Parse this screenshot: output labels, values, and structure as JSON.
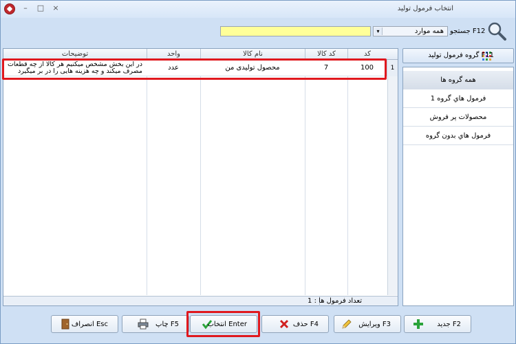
{
  "window": {
    "title": "انتخاب فرمول تولید",
    "min_glyph": "–",
    "max_glyph": "□",
    "close_glyph": "×"
  },
  "search": {
    "placeholder": "",
    "label": "جستجو F12",
    "filter_value": "همه موارد",
    "dropdown_glyph": "▾"
  },
  "grid": {
    "columns": [
      "توضیحات",
      "واحد",
      "نام کالا",
      "کد کالا",
      "کد"
    ],
    "rows": [
      {
        "description": "در این بخش مشخص میکنیم هر کالا از چه قطعات مصرف میکند و چه هزینه هایی را در بر میگیرد",
        "unit": "عدد",
        "product_name": "محصول تولیدی من",
        "product_code": "7",
        "code": "100",
        "row_number": "1"
      }
    ],
    "footer_count": "تعداد فرمول ها : 1"
  },
  "groups": {
    "button_label": "گروه فرمول تولید F11",
    "items": [
      "همه گروه ها",
      "فرمول هاي گروه 1",
      "محصولات پر فروش",
      "فرمول هاي بدون گروه"
    ]
  },
  "buttons": {
    "new": "جدید F2",
    "edit": "ویرایش F3",
    "delete": "حذف F4",
    "select": "انتخاب Enter",
    "print": "چاپ F5",
    "cancel": "انصراف Esc"
  },
  "colors": {
    "search_bg": "#ffff99",
    "highlight_red": "#e0181e",
    "new_icon": "#2aa33a",
    "delete_icon": "#d02020",
    "check_icon": "#2aa33a"
  }
}
